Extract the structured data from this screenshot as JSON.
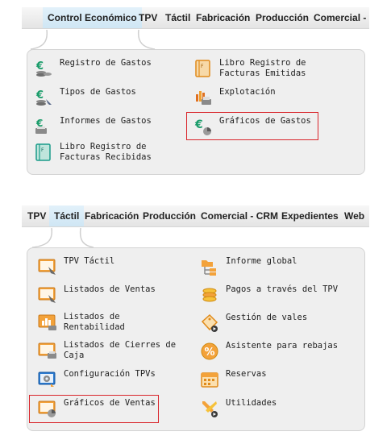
{
  "section1": {
    "menu": [
      "Control Económico",
      "TPV",
      "Táctil",
      "Fabricación",
      "Producción",
      "Comercial -"
    ],
    "items": [
      {
        "label": "Registro de Gastos",
        "icon": "euro-coins-icon"
      },
      {
        "label": "Libro Registro de\nFacturas Emitidas",
        "icon": "ledger-book-icon"
      },
      {
        "label": "Tipos de Gastos",
        "icon": "euro-coins-icon"
      },
      {
        "label": "Explotación",
        "icon": "chart-printer-icon"
      },
      {
        "label": "Informes de Gastos",
        "icon": "euro-printer-icon"
      },
      {
        "label": "Gráficos de Gastos",
        "icon": "euro-pie-chart-icon"
      },
      {
        "label": "Libro Registro de\nFacturas Recibidas",
        "icon": "ledger-book-icon"
      }
    ]
  },
  "section2": {
    "menu": [
      "TPV",
      "Táctil",
      "Fabricación",
      "Producción",
      "Comercial - CRM",
      "Expedientes",
      "Web"
    ],
    "items": [
      {
        "label": "TPV Táctil",
        "icon": "touch-screen-icon"
      },
      {
        "label": "Informe global",
        "icon": "folder-tree-icon"
      },
      {
        "label": "Listados de Ventas",
        "icon": "touch-screen-icon"
      },
      {
        "label": "Pagos a través del TPV",
        "icon": "coins-icon"
      },
      {
        "label": "Listados de\nRentabilidad",
        "icon": "bar-chart-printer-icon"
      },
      {
        "label": "Gestión de vales",
        "icon": "voucher-tag-icon"
      },
      {
        "label": "Listados de Cierres de\nCaja",
        "icon": "screen-printer-icon"
      },
      {
        "label": "Asistente para rebajas",
        "icon": "percent-badge-icon"
      },
      {
        "label": "Configuración TPVs",
        "icon": "gear-screen-icon"
      },
      {
        "label": "Reservas",
        "icon": "calendar-icon"
      },
      {
        "label": "Gráficos de Ventas",
        "icon": "screen-pie-chart-icon"
      },
      {
        "label": "Utilidades",
        "icon": "tools-icon"
      }
    ]
  },
  "colors": {
    "highlight": "#d9252b",
    "panel": "#efefef",
    "active_tab": "#cfe6f4"
  }
}
